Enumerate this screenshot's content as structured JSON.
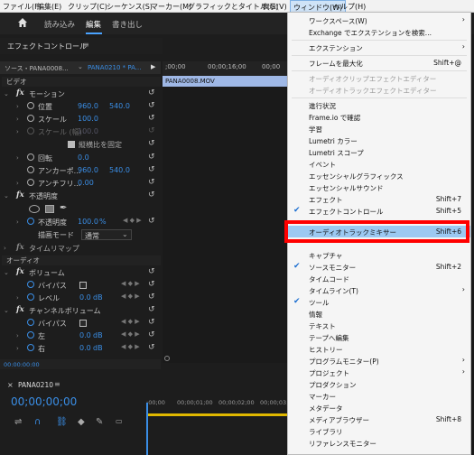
{
  "menubar": {
    "items": [
      "ファイル(F)",
      "編集(E)",
      "クリップ(C)",
      "シーケンス(S)",
      "マーカー(M)",
      "グラフィックとタイトル(G)",
      "表示(V)",
      "ウィンドウ(W)",
      "ヘルプ(H)"
    ]
  },
  "workspace_tabs": [
    "読み込み",
    "編集",
    "書き出し"
  ],
  "effect_controls": {
    "title": "エフェクトコントロール",
    "source": "ソース・PANA0008...",
    "clip": "PANA0210 * PA...",
    "video_label": "ビデオ",
    "motion": "モーション",
    "position": {
      "label": "位置",
      "x": "960.0",
      "y": "540.0"
    },
    "scale": {
      "label": "スケール",
      "value": "100.0"
    },
    "scale_width": {
      "label": "スケール (幅)",
      "value": "100.0"
    },
    "uniform_scale": "縦横比を固定",
    "rotation": {
      "label": "回転",
      "value": "0.0"
    },
    "anchor": {
      "label": "アンカーポ...",
      "x": "960.0",
      "y": "540.0"
    },
    "antiflicker": {
      "label": "アンチフリ...",
      "value": "0.00"
    },
    "opacity_section": "不透明度",
    "opacity": {
      "label": "不透明度",
      "value": "100.0",
      "unit": "%"
    },
    "blend": {
      "label": "描画モード",
      "value": "通常"
    },
    "time_remap": "タイムリマップ",
    "audio_label": "オーディオ",
    "volume": "ボリューム",
    "bypass": "バイパス",
    "level": {
      "label": "レベル",
      "value": "0.0",
      "unit": "dB"
    },
    "channel_volume": "チャンネルボリューム",
    "left": {
      "label": "左",
      "value": "0.0",
      "unit": "dB"
    },
    "right": {
      "label": "右",
      "value": "0.0",
      "unit": "dB"
    },
    "timecode_small": "00:00:00:00"
  },
  "timeline": {
    "t0": ";00;00",
    "t1": "00;00;16;00",
    "t2": "00;00",
    "clip_name": "PANA0008.MOV"
  },
  "bottom": {
    "seq_name": "PANA0210",
    "timecode": "00;00;00;00",
    "ruler": [
      ":00;00",
      "00;00;01;00",
      "00;00;02;00",
      "00;00;03;00"
    ]
  },
  "menu": {
    "workspace": "ワークスペース(W)",
    "exchange": "Exchange でエクステンションを検索...",
    "extensions": "エクステンション",
    "maximize": "フレームを最大化",
    "maximize_sc": "Shift+@",
    "audio_clip_effect_editor": "オーディオクリップエフェクトエディター",
    "audio_track_effect_editor": "オーディオトラックエフェクトエディター",
    "progress": "進行状況",
    "frameio": "Frame.io で確認",
    "learn": "学習",
    "lumetri_color": "Lumetri カラー",
    "lumetri_scopes": "Lumetri スコープ",
    "events": "イベント",
    "essential_graphics": "エッセンシャルグラフィックス",
    "essential_sound": "エッセンシャルサウンド",
    "effects": "エフェクト",
    "effects_sc": "Shift+7",
    "effect_controls": "エフェクトコントロール",
    "effect_controls_sc": "Shift+5",
    "audio_track_mixer": "オーディオトラックミキサー",
    "audio_track_mixer_sc": "Shift+6",
    "capture": "キャプチャ",
    "source_monitor": "ソースモニター",
    "source_monitor_sc": "Shift+2",
    "timecode": "タイムコード",
    "timeline": "タイムライン(T)",
    "tools": "ツール",
    "info": "情報",
    "text": "テキスト",
    "tape_edit": "テープへ編集",
    "history": "ヒストリー",
    "program_monitor": "プログラムモニター(P)",
    "project": "プロジェクト",
    "production": "プロダクション",
    "markers": "マーカー",
    "metadata": "メタデータ",
    "media_browser": "メディアブラウザー",
    "media_browser_sc": "Shift+8",
    "libraries": "ライブラリ",
    "reference_monitor": "リファレンスモニター"
  },
  "colors": {
    "accent": "#3a8ee6",
    "highlight": "#9cc9f2",
    "callout": "#ff0000"
  }
}
